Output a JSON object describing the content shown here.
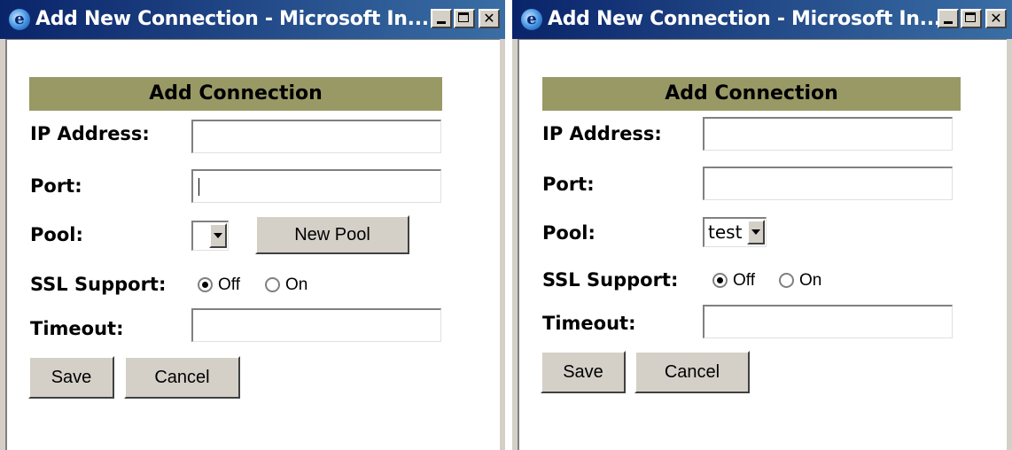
{
  "windows": [
    {
      "title": "Add New Connection - Microsoft In...",
      "form_header": "Add Connection",
      "labels": {
        "ip": "IP Address:",
        "port": "Port:",
        "pool": "Pool:",
        "ssl": "SSL Support:",
        "timeout": "Timeout:"
      },
      "fields": {
        "ip": "",
        "port": "",
        "timeout": ""
      },
      "pool_selected": "",
      "new_pool_label": "New Pool",
      "ssl_options": {
        "off": "Off",
        "on": "On"
      },
      "ssl_selected": "off",
      "save_label": "Save",
      "cancel_label": "Cancel"
    },
    {
      "title": "Add New Connection - Microsoft In...",
      "form_header": "Add Connection",
      "labels": {
        "ip": "IP Address:",
        "port": "Port:",
        "pool": "Pool:",
        "ssl": "SSL Support:",
        "timeout": "Timeout:"
      },
      "fields": {
        "ip": "",
        "port": "",
        "timeout": ""
      },
      "pool_selected": "test",
      "ssl_options": {
        "off": "Off",
        "on": "On"
      },
      "ssl_selected": "off",
      "save_label": "Save",
      "cancel_label": "Cancel"
    }
  ],
  "icons": {
    "titlebar": "internet-explorer-icon",
    "minimize": "minimize-icon",
    "maximize": "maximize-icon",
    "close": "close-icon"
  },
  "colors": {
    "titlebar_start": "#0a246a",
    "titlebar_end": "#3a6ea5",
    "header_bg": "#999966",
    "chrome": "#d4d0c8"
  }
}
